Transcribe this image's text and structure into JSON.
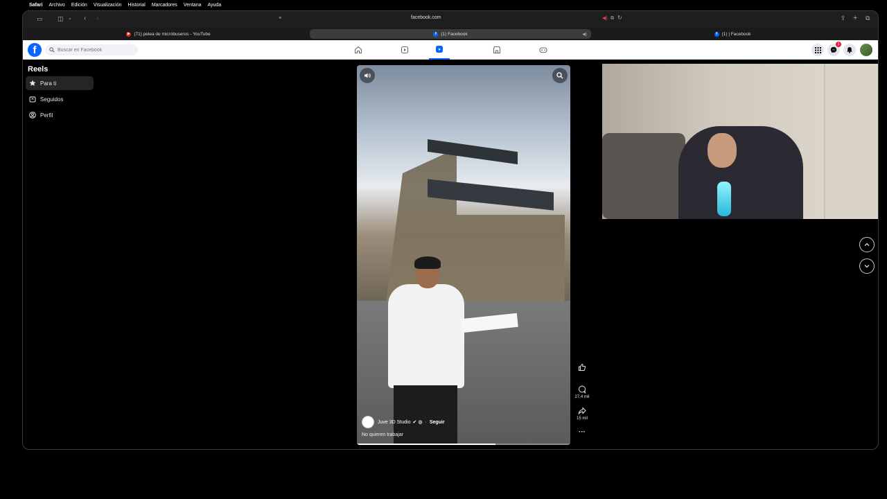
{
  "menubar": {
    "items": [
      "Safari",
      "Archivo",
      "Edición",
      "Visualización",
      "Historial",
      "Marcadores",
      "Ventana",
      "Ayuda"
    ]
  },
  "browser": {
    "url": "facebook.com",
    "tabs": [
      {
        "title": "(71) pelea de microbuseros - YouTube",
        "active": false
      },
      {
        "title": "(1) Facebook",
        "active": true
      },
      {
        "title": "(1) | Facebook",
        "active": false
      }
    ]
  },
  "facebook": {
    "search_placeholder": "Buscar en Facebook",
    "notification_count": "1"
  },
  "sidebar": {
    "title": "Reels",
    "items": [
      {
        "label": "Para ti",
        "active": true
      },
      {
        "label": "Seguidos",
        "active": false
      },
      {
        "label": "Perfil",
        "active": false
      }
    ]
  },
  "reel": {
    "author": "Juve 3D Studio",
    "follow_label": "Seguir",
    "separator": "·",
    "caption": "No quieren trabajar",
    "comments": "27,4 mil",
    "shares": "15 mil",
    "progress_fraction": 0.65
  },
  "colors": {
    "brand": "#0866ff",
    "badge": "#e41e3f"
  }
}
